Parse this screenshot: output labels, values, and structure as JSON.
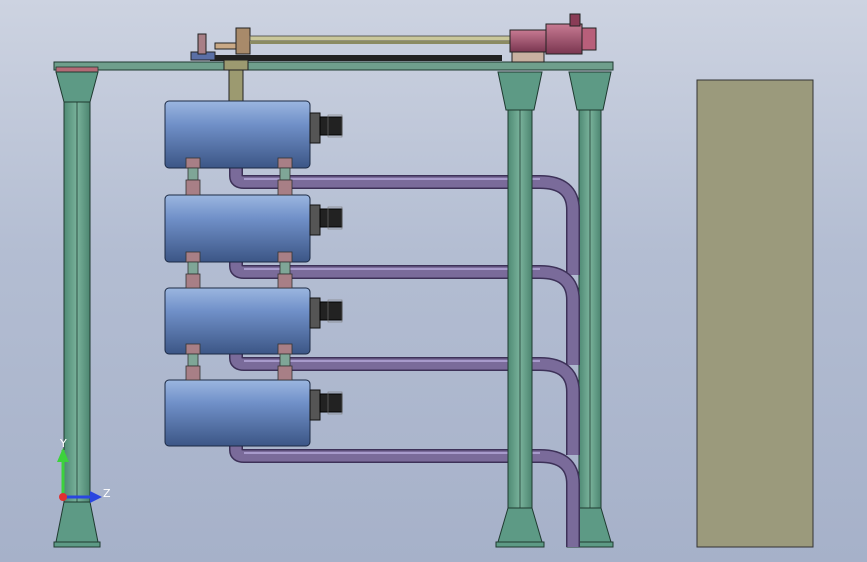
{
  "view": {
    "background_top": "#cdd3e1",
    "background_bottom": "#a6b1c9"
  },
  "colors": {
    "column_green": "#5d9a85",
    "column_dark": "#1f3a30",
    "beam": "#6f9f8c",
    "cylinder": "#6f8fc6",
    "cylinder_dark": "#2e4470",
    "pipe": "#7a6b9a",
    "pipe_dark": "#3d3158",
    "bracket": "#a87f86",
    "panel": "#9b9a7c",
    "motor": "#a2506a",
    "rail": "#c9c79a"
  },
  "triad": {
    "y_label": "Y",
    "z_label": "Z",
    "y_color": "#3cd23c",
    "z_color": "#2a46e0",
    "x_color": "#e03030"
  },
  "components": {
    "left_column": "left-support-column",
    "mid_column": "middle-support-column",
    "right_column": "right-support-column",
    "cylinders": [
      "tank-1",
      "tank-2",
      "tank-3",
      "tank-4"
    ],
    "pipes": [
      "pipe-1",
      "pipe-2",
      "pipe-3",
      "pipe-4"
    ],
    "panel": "side-panel",
    "actuator": "linear-actuator-with-motor"
  }
}
